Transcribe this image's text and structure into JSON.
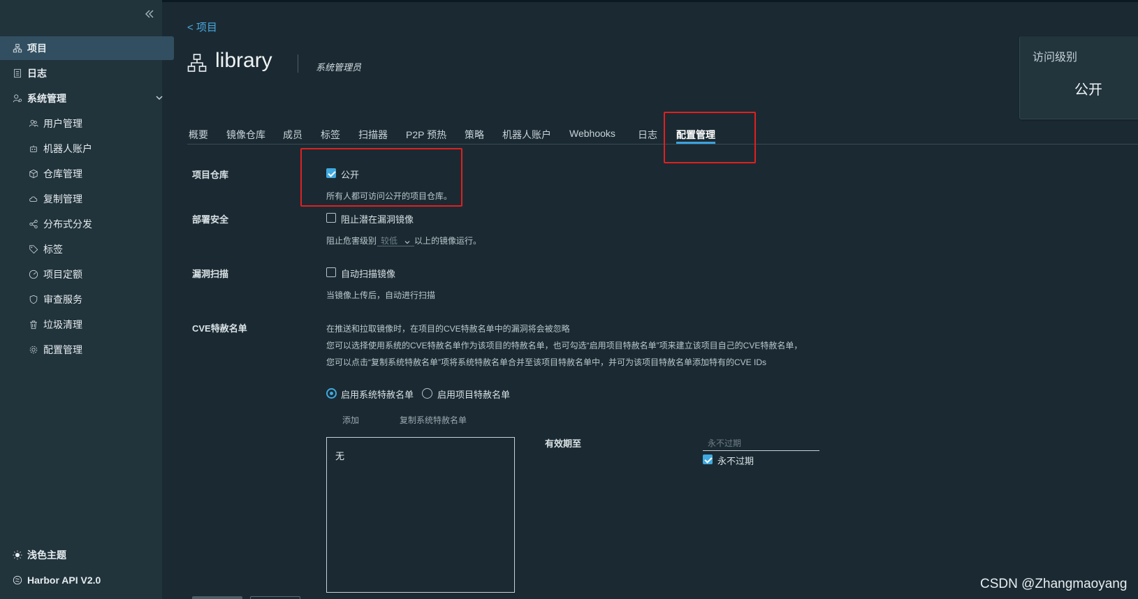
{
  "sidebar": {
    "items": [
      {
        "label": "项目",
        "icon": "project-icon"
      },
      {
        "label": "日志",
        "icon": "log-icon"
      },
      {
        "label": "系统管理",
        "icon": "admin-icon"
      },
      {
        "label": "用户管理",
        "icon": "users-icon"
      },
      {
        "label": "机器人账户",
        "icon": "robot-icon"
      },
      {
        "label": "仓库管理",
        "icon": "registry-icon"
      },
      {
        "label": "复制管理",
        "icon": "replication-icon"
      },
      {
        "label": "分布式分发",
        "icon": "share-icon"
      },
      {
        "label": "标签",
        "icon": "tag-icon"
      },
      {
        "label": "项目定额",
        "icon": "quota-icon"
      },
      {
        "label": "审查服务",
        "icon": "shield-icon"
      },
      {
        "label": "垃圾清理",
        "icon": "trash-icon"
      },
      {
        "label": "配置管理",
        "icon": "gear-icon"
      }
    ],
    "footer": [
      {
        "label": "浅色主题",
        "icon": "sun-icon"
      },
      {
        "label": "Harbor API V2.0",
        "icon": "api-icon"
      }
    ]
  },
  "header": {
    "back_label": "< 项目",
    "title": "library",
    "role": "系统管理员"
  },
  "access": {
    "label": "访问级别",
    "value": "公开"
  },
  "tabs": [
    "概要",
    "镜像仓库",
    "成员",
    "标签",
    "扫描器",
    "P2P 预热",
    "策略",
    "机器人账户",
    "Webhooks",
    "日志",
    "配置管理"
  ],
  "form": {
    "repo": {
      "label": "项目仓库",
      "checkbox": "公开",
      "checked": true,
      "help": "所有人都可访问公开的项目仓库。"
    },
    "deploy": {
      "label": "部署安全",
      "checkbox": "阻止潜在漏洞镜像",
      "checked": false,
      "help_before": "阻止危害级别",
      "select_value": "较低",
      "help_after": "以上的镜像运行。"
    },
    "scan": {
      "label": "漏洞扫描",
      "checkbox": "自动扫描镜像",
      "checked": false,
      "help": "当镜像上传后，自动进行扫描"
    },
    "cve": {
      "label": "CVE特赦名单",
      "desc1": "在推送和拉取镜像时，在项目的CVE特赦名单中的漏洞将会被忽略",
      "desc2": "您可以选择使用系统的CVE特赦名单作为该项目的特赦名单，也可勾选“启用项目特赦名单”项来建立该项目自己的CVE特赦名单，",
      "desc3": "您可以点击“复制系统特赦名单”项将系统特赦名单合并至该项目特赦名单中，并可为该项目特赦名单添加特有的CVE IDs",
      "radio_system": "启用系统特赦名单",
      "radio_project": "启用项目特赦名单",
      "add": "添加",
      "copy": "复制系统特赦名单",
      "list_empty": "无",
      "expiry_label": "有效期至",
      "expiry_placeholder": "永不过期",
      "never_expire": "永不过期",
      "never_expire_checked": true
    }
  },
  "watermark": "CSDN @Zhangmaoyang",
  "colors": {
    "accent": "#3fa9e0",
    "highlight": "#e02020",
    "sidebar_active": "#324f61"
  }
}
